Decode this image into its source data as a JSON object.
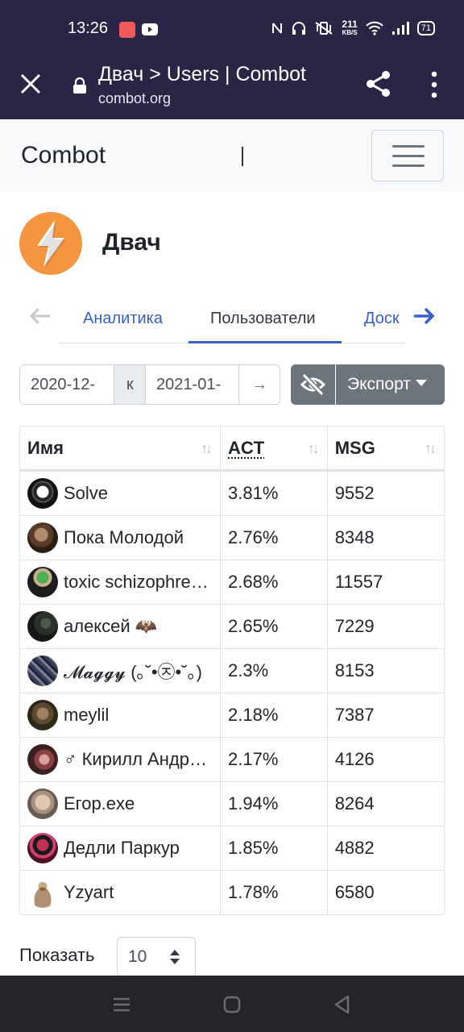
{
  "status": {
    "time": "13:26",
    "speed_value": "211",
    "speed_unit": "KB/S",
    "battery": "71"
  },
  "browser": {
    "title": "Двач > Users | Combot",
    "host": "combot.org"
  },
  "site": {
    "brand": "Combot"
  },
  "group": {
    "name": "Двач"
  },
  "tabs": [
    {
      "label": "Аналитика"
    },
    {
      "label": "Пользователи"
    },
    {
      "label": "Доск"
    }
  ],
  "filters": {
    "date_from": "2020-12-",
    "separator": "к",
    "date_to": "2021-01-",
    "go_arrow": "→",
    "export_label": "Экспорт"
  },
  "table": {
    "columns": [
      "Имя",
      "ACT",
      "MSG"
    ],
    "rows": [
      {
        "name": "Solve",
        "act": "3.81%",
        "msg": "9552"
      },
      {
        "name": "Пока Молодой",
        "act": "2.76%",
        "msg": "8348"
      },
      {
        "name": "toxic schizophrenic",
        "act": "2.68%",
        "msg": "11557"
      },
      {
        "name": "алексей 🦇",
        "act": "2.65%",
        "msg": "7229"
      },
      {
        "name": "𝓜𝓪𝓰𝓰𝔂 (｡˘•㉨•˘｡)",
        "act": "2.3%",
        "msg": "8153"
      },
      {
        "name": "meylil",
        "act": "2.18%",
        "msg": "7387"
      },
      {
        "name": "♂ Кирилл Андреевич",
        "act": "2.17%",
        "msg": "4126"
      },
      {
        "name": "Егор.exe",
        "act": "1.94%",
        "msg": "8264"
      },
      {
        "name": "Дедли Паркур",
        "act": "1.85%",
        "msg": "4882"
      },
      {
        "name": "Yzyart",
        "act": "1.78%",
        "msg": "6580"
      }
    ]
  },
  "pagination": {
    "show_label": "Показать",
    "page_size": "10"
  },
  "colors": {
    "accent": "#3760c8",
    "header_bg": "#2b2545",
    "button_gray": "#6c757d",
    "logo_orange": "#f5953f"
  }
}
